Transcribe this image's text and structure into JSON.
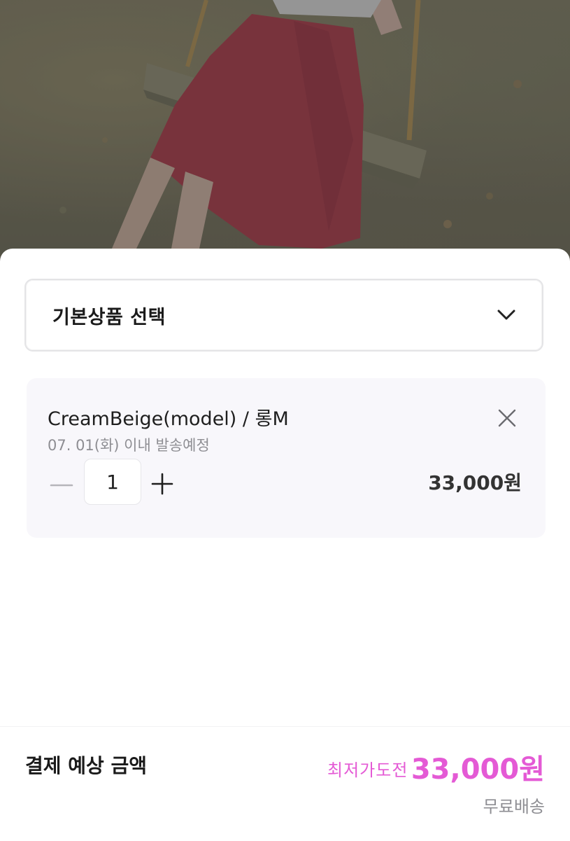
{
  "product_image": {
    "description_icon": "product-photo"
  },
  "option_select": {
    "label": "기본상품 선택",
    "icon": "chevron-down-icon"
  },
  "selected_option": {
    "name": "CreamBeige(model) / 롱M",
    "shipping_note": "07. 01(화) 이내 발송예정",
    "quantity": "1",
    "price": "33,000원",
    "remove_icon": "close-icon",
    "minus_icon": "minus-icon",
    "plus_icon": "plus-icon"
  },
  "footer": {
    "total_label": "결제 예상 금액",
    "lowest_tag": "최저가도전",
    "total_price": "33,000원",
    "shipping": "무료배송"
  },
  "colors": {
    "accent": "#e45ad5",
    "card_bg": "#f8f7fb",
    "muted_text": "#8e8e93"
  }
}
